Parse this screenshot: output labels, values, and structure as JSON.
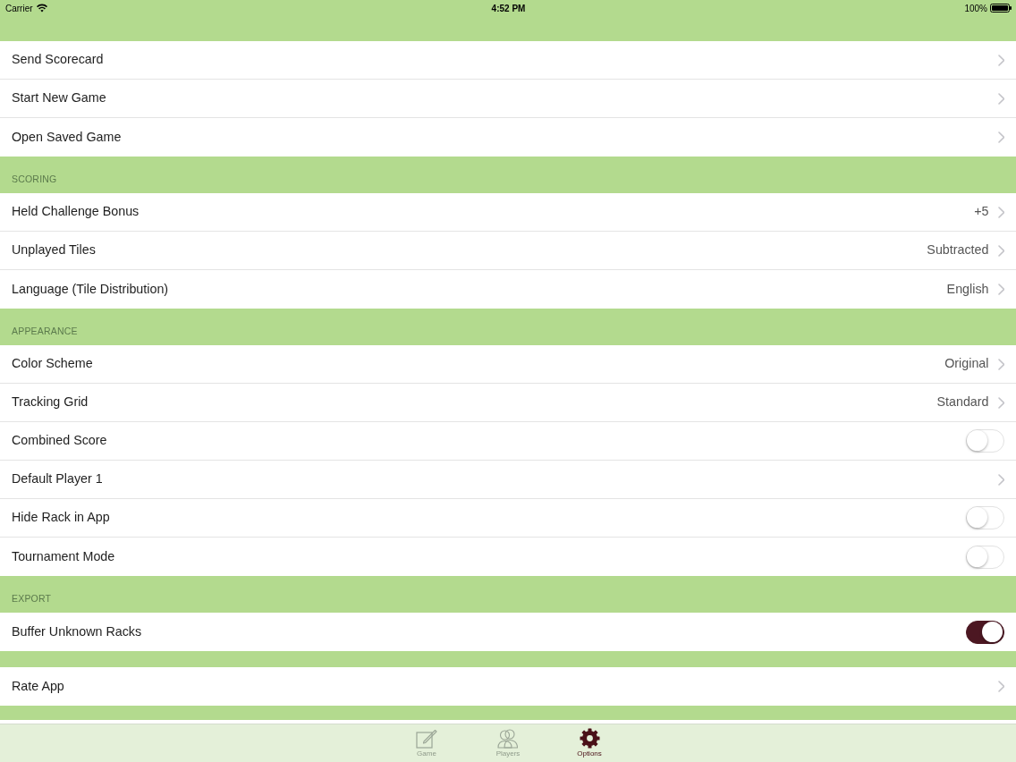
{
  "status_bar": {
    "carrier": "Carrier",
    "time": "4:52 PM",
    "battery": "100%"
  },
  "sections": [
    {
      "rows": [
        {
          "kind": "link",
          "label": "Send Scorecard"
        },
        {
          "kind": "link",
          "label": "Start New Game"
        },
        {
          "kind": "link",
          "label": "Open Saved Game"
        }
      ]
    },
    {
      "header": "SCORING",
      "rows": [
        {
          "kind": "link",
          "label": "Held Challenge Bonus",
          "value": "+5"
        },
        {
          "kind": "link",
          "label": "Unplayed Tiles",
          "value": "Subtracted"
        },
        {
          "kind": "link",
          "label": "Language (Tile Distribution)",
          "value": "English"
        }
      ]
    },
    {
      "header": "APPEARANCE",
      "rows": [
        {
          "kind": "link",
          "label": "Color Scheme",
          "value": "Original"
        },
        {
          "kind": "link",
          "label": "Tracking Grid",
          "value": "Standard"
        },
        {
          "kind": "toggle",
          "label": "Combined Score",
          "on": false
        },
        {
          "kind": "link",
          "label": "Default Player 1"
        },
        {
          "kind": "toggle",
          "label": "Hide Rack in App",
          "on": false
        },
        {
          "kind": "toggle",
          "label": "Tournament Mode",
          "on": false
        }
      ]
    },
    {
      "header": "EXPORT",
      "rows": [
        {
          "kind": "toggle",
          "label": "Buffer Unknown Racks",
          "on": true
        }
      ]
    },
    {
      "rows": [
        {
          "kind": "link",
          "label": "Rate App"
        }
      ]
    }
  ],
  "tab_bar": {
    "tabs": [
      {
        "label": "Game",
        "selected": false
      },
      {
        "label": "Players",
        "selected": false
      },
      {
        "label": "Options",
        "selected": true
      }
    ]
  }
}
